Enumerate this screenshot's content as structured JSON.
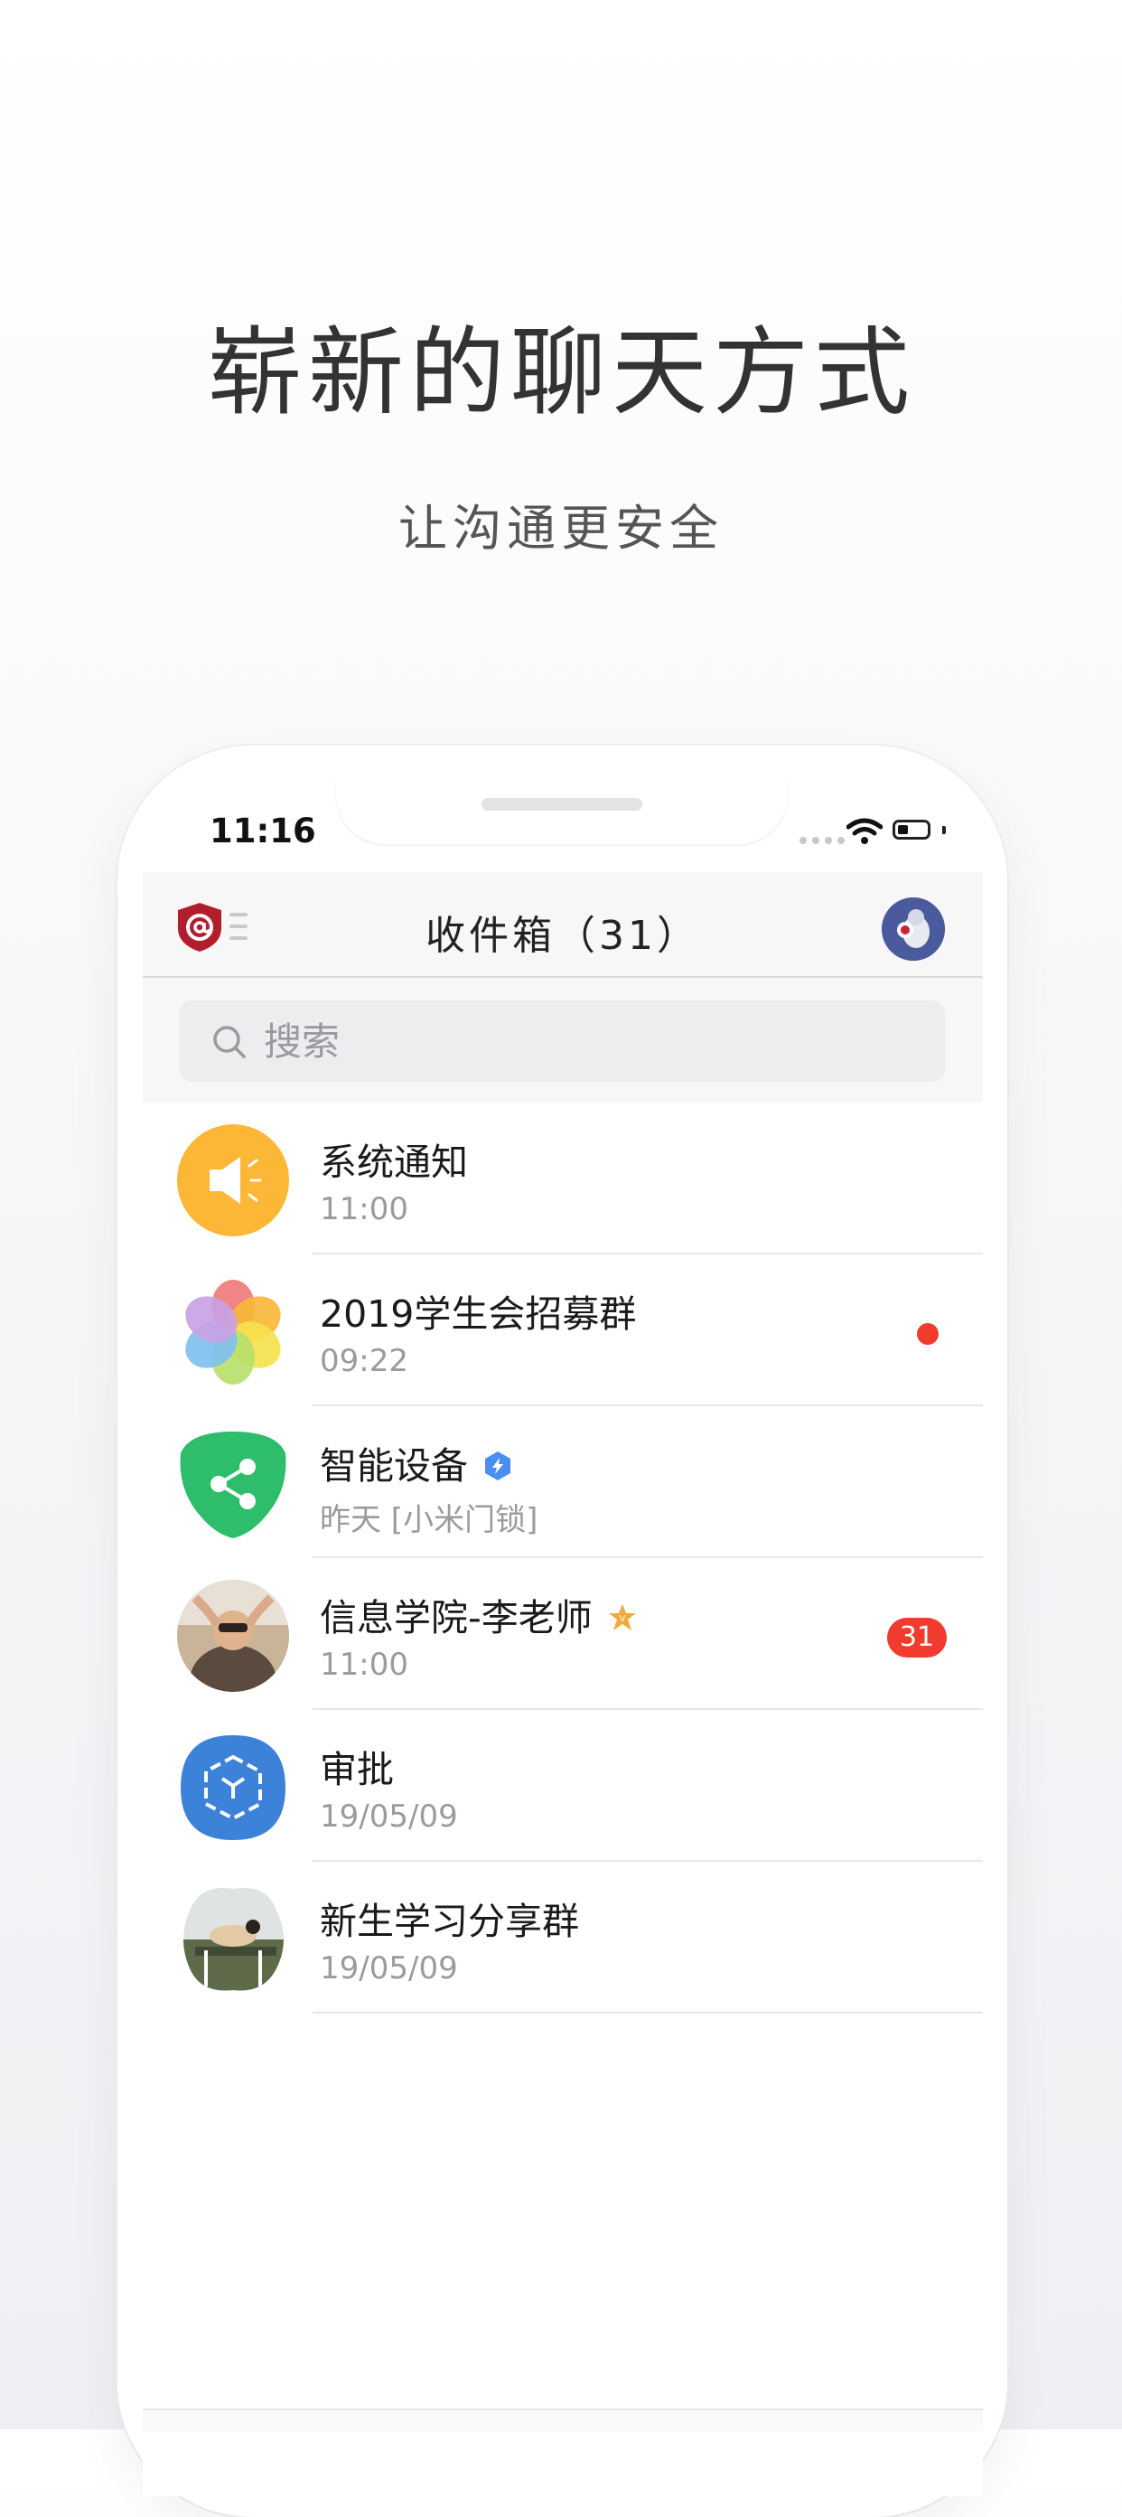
{
  "promo": {
    "headline": "崭新的聊天方式",
    "subheadline": "让沟通更安全"
  },
  "status_bar": {
    "time": "11:16"
  },
  "nav": {
    "title": "收件箱（31）"
  },
  "search": {
    "placeholder": "搜索"
  },
  "chats": [
    {
      "name": "系统通知",
      "time": "11:00",
      "avatar_icon": "speaker-icon"
    },
    {
      "name": "2019学生会招募群",
      "time": "09:22",
      "avatar_icon": "flower-icon",
      "unread_dot": true
    },
    {
      "name": "智能设备",
      "time": "昨天 [小米门锁]",
      "avatar_icon": "share-icon",
      "badge_icon": "verified-bolt-icon"
    },
    {
      "name": "信息学院-李老师",
      "time": "11:00",
      "avatar_icon": "photo-avatar",
      "badge_icon": "vip-star-icon",
      "unread_count": "31"
    },
    {
      "name": "审批",
      "time": "19/05/09",
      "avatar_icon": "cube-icon"
    },
    {
      "name": "新生学习分享群",
      "time": "19/05/09",
      "avatar_icon": "photo-avatar"
    }
  ],
  "colors": {
    "accent_red": "#f23b2f",
    "notify_yellow": "#fbb735",
    "device_green": "#2ebd6b",
    "approval_blue": "#3b82d8",
    "verified_blue": "#4a8ef0",
    "vip_orange": "#f2a93b"
  }
}
